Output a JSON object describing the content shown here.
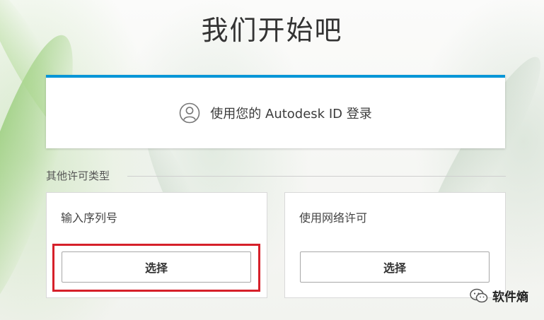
{
  "page": {
    "title": "我们开始吧",
    "accent_color": "#0696d7"
  },
  "signin": {
    "icon": "user-circle-icon",
    "label": "使用您的 Autodesk ID 登录"
  },
  "other_licenses": {
    "section_label": "其他许可类型",
    "options": [
      {
        "title": "输入序列号",
        "button_label": "选择"
      },
      {
        "title": "使用网络许可",
        "button_label": "选择"
      }
    ]
  },
  "annotation": {
    "highlight_color": "#d6202a"
  },
  "watermark": {
    "icon": "wechat-icon",
    "text": "软件熵"
  }
}
